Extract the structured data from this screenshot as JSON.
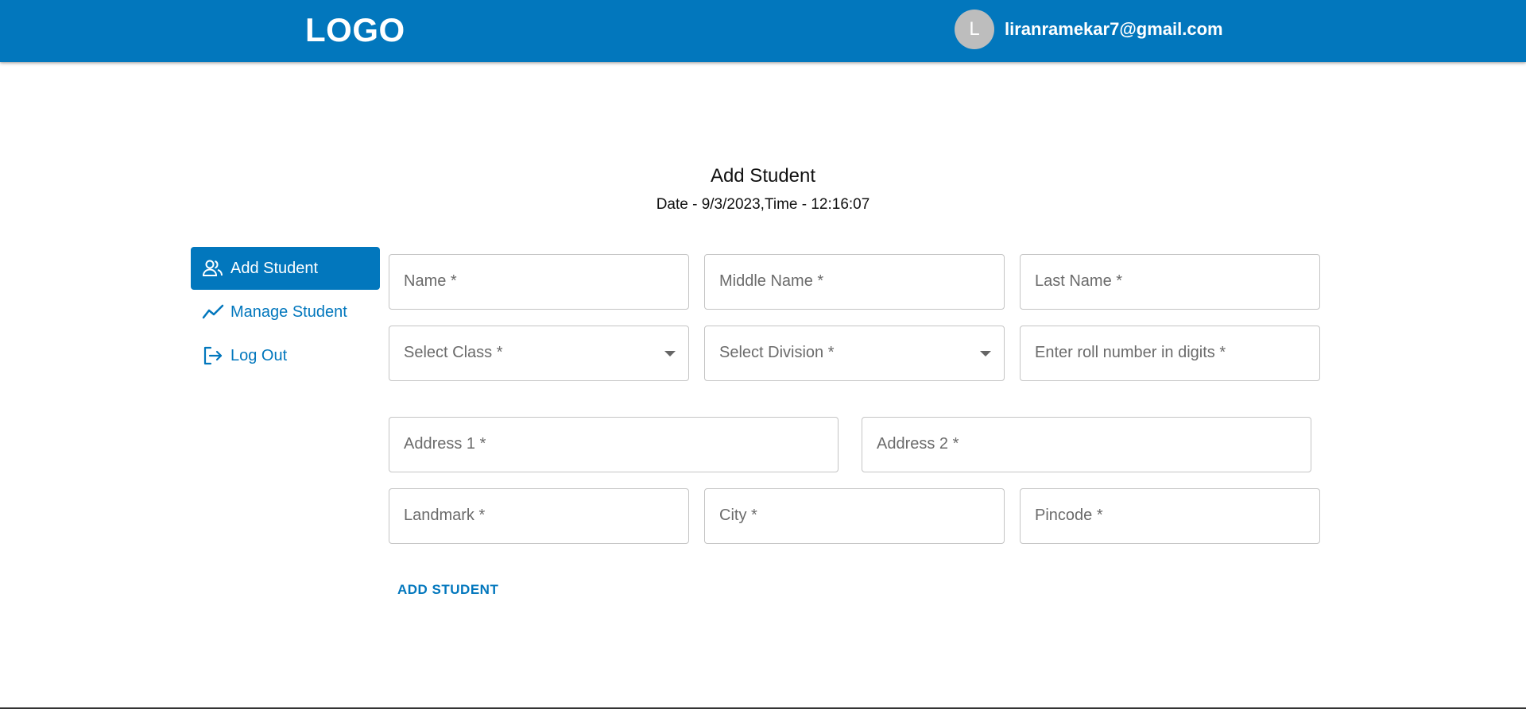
{
  "header": {
    "logo": "LOGO",
    "avatar_initial": "L",
    "user_email": "liranramekar7@gmail.com",
    "brand_color": "#0277bd"
  },
  "page": {
    "title": "Add Student",
    "datetime": "Date - 9/3/2023,Time - 12:16:07"
  },
  "sidebar": {
    "items": [
      {
        "label": "Add Student",
        "icon": "people-icon",
        "active": true
      },
      {
        "label": "Manage Student",
        "icon": "trend-line-icon",
        "active": false
      },
      {
        "label": "Log Out",
        "icon": "logout-icon",
        "active": false
      }
    ]
  },
  "form": {
    "name": {
      "placeholder": "Name *",
      "value": ""
    },
    "middle_name": {
      "placeholder": "Middle Name *",
      "value": ""
    },
    "last_name": {
      "placeholder": "Last Name *",
      "value": ""
    },
    "class": {
      "placeholder": "Select Class *",
      "value": ""
    },
    "division": {
      "placeholder": "Select Division *",
      "value": ""
    },
    "roll_number": {
      "placeholder": "Enter roll number in digits *",
      "value": ""
    },
    "address1": {
      "placeholder": "Address 1 *",
      "value": ""
    },
    "address2": {
      "placeholder": "Address 2 *",
      "value": ""
    },
    "landmark": {
      "placeholder": "Landmark *",
      "value": ""
    },
    "city": {
      "placeholder": "City *",
      "value": ""
    },
    "pincode": {
      "placeholder": "Pincode *",
      "value": ""
    },
    "submit_label": "ADD STUDENT"
  }
}
